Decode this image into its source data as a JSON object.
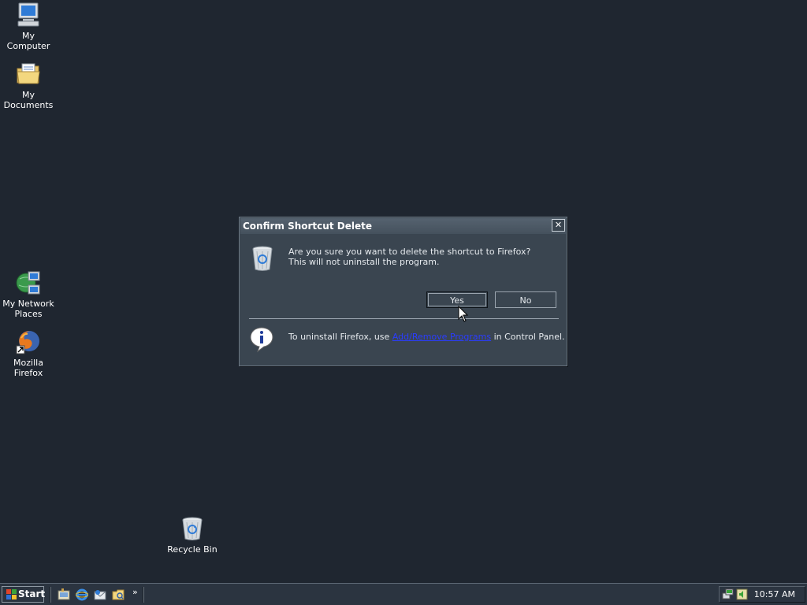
{
  "desktop": {
    "icons": [
      {
        "label": "My Computer",
        "icon": "my-computer-icon"
      },
      {
        "label": "My Documents",
        "icon": "my-documents-icon"
      },
      {
        "label": "My Network Places",
        "icon": "network-places-icon"
      },
      {
        "label": "Mozilla Firefox",
        "icon": "firefox-icon"
      },
      {
        "label": "Recycle Bin",
        "icon": "recycle-bin-icon"
      }
    ],
    "background_color": "#1f2630"
  },
  "dialog": {
    "title": "Confirm Shortcut Delete",
    "close_label": "✕",
    "message": "Are you sure you want to delete the shortcut to Firefox? This will not uninstall the program.",
    "yes_label": "Yes",
    "no_label": "No",
    "info_prefix": "To uninstall Firefox, use ",
    "info_link": "Add/Remove Programs",
    "info_suffix": " in Control Panel.",
    "link_color": "#2a3cff"
  },
  "taskbar": {
    "start_label": "Start",
    "quick_launch": [
      "show-desktop-icon",
      "internet-explorer-icon",
      "outlook-express-icon",
      "windows-explorer-icon"
    ],
    "more_label": "»",
    "clock": "10:57 AM"
  }
}
